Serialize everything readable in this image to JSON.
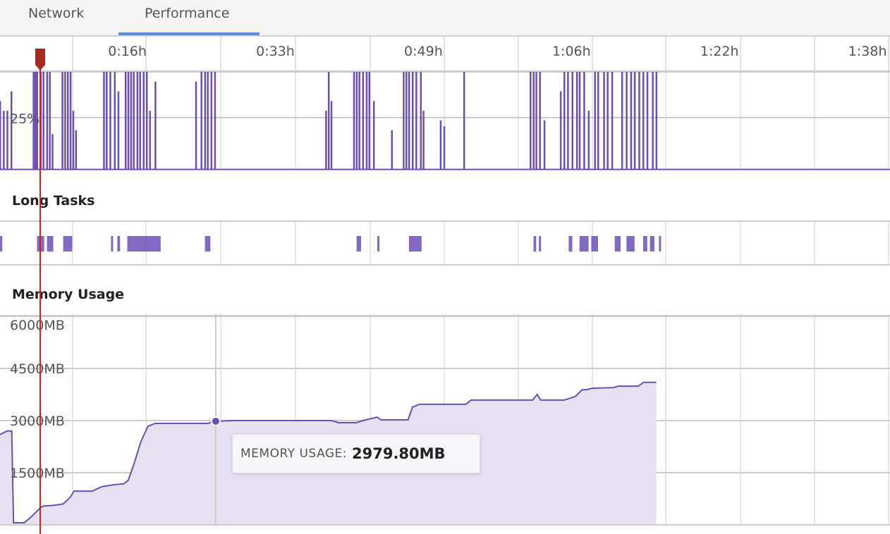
{
  "tabs": [
    {
      "label": "Network",
      "active": false
    },
    {
      "label": "Performance",
      "active": true
    }
  ],
  "colors": {
    "series": "#6c4fb6",
    "fill": "#e6e1f1",
    "marker": "#d0201c",
    "active_tab": "#5b8dd9"
  },
  "timeline": {
    "ticks": [
      "0:16h",
      "0:33h",
      "0:49h",
      "1:06h",
      "1:22h",
      "1:38h"
    ],
    "tick_minutes": [
      16.4,
      32.8,
      49.2,
      65.6,
      82,
      98.4
    ],
    "marker_minute": 4.45,
    "marker_icon": "playhead-marker-icon"
  },
  "cpu": {
    "ylabel_tick": "25%",
    "ylim": [
      0,
      50
    ],
    "spikes": [
      [
        0,
        35
      ],
      [
        0.4,
        30
      ],
      [
        0.8,
        30
      ],
      [
        1.25,
        40
      ],
      [
        3.7,
        50
      ],
      [
        3.9,
        50
      ],
      [
        4.1,
        50
      ],
      [
        4.5,
        50
      ],
      [
        4.8,
        50
      ],
      [
        5.2,
        50
      ],
      [
        5.5,
        50
      ],
      [
        5.8,
        18
      ],
      [
        6.9,
        50
      ],
      [
        7.2,
        50
      ],
      [
        7.5,
        50
      ],
      [
        7.8,
        50
      ],
      [
        8.1,
        30
      ],
      [
        8.4,
        20
      ],
      [
        11.5,
        50
      ],
      [
        11.8,
        50
      ],
      [
        12.2,
        50
      ],
      [
        12.7,
        50
      ],
      [
        13.1,
        40
      ],
      [
        13.9,
        50
      ],
      [
        14.2,
        50
      ],
      [
        14.5,
        50
      ],
      [
        14.8,
        50
      ],
      [
        15.2,
        50
      ],
      [
        15.5,
        50
      ],
      [
        15.9,
        50
      ],
      [
        16.25,
        50
      ],
      [
        16.6,
        30
      ],
      [
        17.2,
        45
      ],
      [
        21.7,
        45
      ],
      [
        22.3,
        50
      ],
      [
        22.7,
        50
      ],
      [
        23.0,
        50
      ],
      [
        23.4,
        50
      ],
      [
        23.8,
        50
      ],
      [
        36.1,
        30
      ],
      [
        36.4,
        50
      ],
      [
        36.7,
        35
      ],
      [
        39.2,
        50
      ],
      [
        39.5,
        50
      ],
      [
        39.8,
        50
      ],
      [
        40.2,
        50
      ],
      [
        40.6,
        50
      ],
      [
        40.9,
        50
      ],
      [
        41.4,
        35
      ],
      [
        43.4,
        20
      ],
      [
        44.7,
        50
      ],
      [
        45.0,
        50
      ],
      [
        45.3,
        50
      ],
      [
        45.7,
        50
      ],
      [
        46.1,
        50
      ],
      [
        46.6,
        50
      ],
      [
        46.9,
        30
      ],
      [
        48.8,
        25
      ],
      [
        49.2,
        22
      ],
      [
        51.4,
        50
      ],
      [
        58.75,
        50
      ],
      [
        59.1,
        50
      ],
      [
        59.4,
        50
      ],
      [
        59.8,
        50
      ],
      [
        60.3,
        25
      ],
      [
        62.1,
        40
      ],
      [
        62.5,
        50
      ],
      [
        62.9,
        50
      ],
      [
        63.4,
        50
      ],
      [
        63.9,
        50
      ],
      [
        64.2,
        50
      ],
      [
        64.7,
        50
      ],
      [
        65.2,
        30
      ],
      [
        65.9,
        50
      ],
      [
        66.25,
        50
      ],
      [
        66.9,
        50
      ],
      [
        67.3,
        50
      ],
      [
        67.8,
        50
      ],
      [
        68.9,
        50
      ],
      [
        69.4,
        50
      ],
      [
        69.9,
        50
      ],
      [
        70.3,
        50
      ],
      [
        70.8,
        50
      ],
      [
        71.25,
        50
      ],
      [
        71.7,
        50
      ],
      [
        72.3,
        50
      ],
      [
        72.7,
        50
      ]
    ]
  },
  "long_tasks": {
    "title": "Long Tasks",
    "intervals": [
      [
        0,
        0.25
      ],
      [
        4.1,
        4.9
      ],
      [
        5.2,
        5.9
      ],
      [
        7.0,
        8.0
      ],
      [
        12.3,
        12.5
      ],
      [
        13.0,
        13.3
      ],
      [
        14.1,
        17.8
      ],
      [
        22.7,
        23.3
      ],
      [
        39.5,
        40.0
      ],
      [
        41.8,
        42.0
      ],
      [
        45.3,
        46.7
      ],
      [
        59.1,
        59.4
      ],
      [
        59.7,
        59.9
      ],
      [
        63.0,
        63.4
      ],
      [
        64.2,
        65.2
      ],
      [
        65.5,
        66.25
      ],
      [
        68.1,
        68.75
      ],
      [
        69.4,
        70.3
      ],
      [
        71.25,
        71.7
      ],
      [
        72.0,
        72.5
      ],
      [
        73.0,
        73.2
      ]
    ]
  },
  "memory": {
    "title": "Memory Usage",
    "yticks": [
      "6000MB",
      "4500MB",
      "3000MB",
      "1500MB"
    ],
    "ytick_values": [
      6000,
      4500,
      3000,
      1500
    ],
    "ylim": [
      0,
      6000
    ],
    "points": [
      [
        0,
        2600
      ],
      [
        0.8,
        2700
      ],
      [
        1.3,
        2700
      ],
      [
        1.5,
        60
      ],
      [
        2.7,
        60
      ],
      [
        3.5,
        240
      ],
      [
        4.5,
        500
      ],
      [
        4.8,
        540
      ],
      [
        5.9,
        560
      ],
      [
        7.0,
        600
      ],
      [
        7.8,
        800
      ],
      [
        8.2,
        970
      ],
      [
        10.2,
        970
      ],
      [
        11.3,
        1100
      ],
      [
        12.5,
        1150
      ],
      [
        13.7,
        1180
      ],
      [
        14.2,
        1280
      ],
      [
        14.8,
        1720
      ],
      [
        15.6,
        2390
      ],
      [
        16.4,
        2840
      ],
      [
        17.2,
        2920
      ],
      [
        23.0,
        2920
      ],
      [
        23.9,
        2980
      ],
      [
        25.8,
        3000
      ],
      [
        36.7,
        3000
      ],
      [
        37.5,
        2940
      ],
      [
        39.5,
        2940
      ],
      [
        40.2,
        3000
      ],
      [
        41.8,
        3100
      ],
      [
        42.2,
        3020
      ],
      [
        45.2,
        3020
      ],
      [
        45.7,
        3390
      ],
      [
        46.5,
        3470
      ],
      [
        51.6,
        3470
      ],
      [
        52.2,
        3590
      ],
      [
        59.0,
        3590
      ],
      [
        59.5,
        3750
      ],
      [
        59.9,
        3590
      ],
      [
        62.5,
        3590
      ],
      [
        63.7,
        3690
      ],
      [
        64.5,
        3890
      ],
      [
        65.0,
        3890
      ],
      [
        65.6,
        3930
      ],
      [
        68.0,
        3950
      ],
      [
        68.5,
        3990
      ],
      [
        70.7,
        3990
      ],
      [
        71.3,
        4100
      ],
      [
        72.7,
        4100
      ]
    ],
    "hover_minute": 23.9,
    "tooltip": {
      "label": "MEMORY USAGE:",
      "value": "2979.80MB"
    }
  }
}
